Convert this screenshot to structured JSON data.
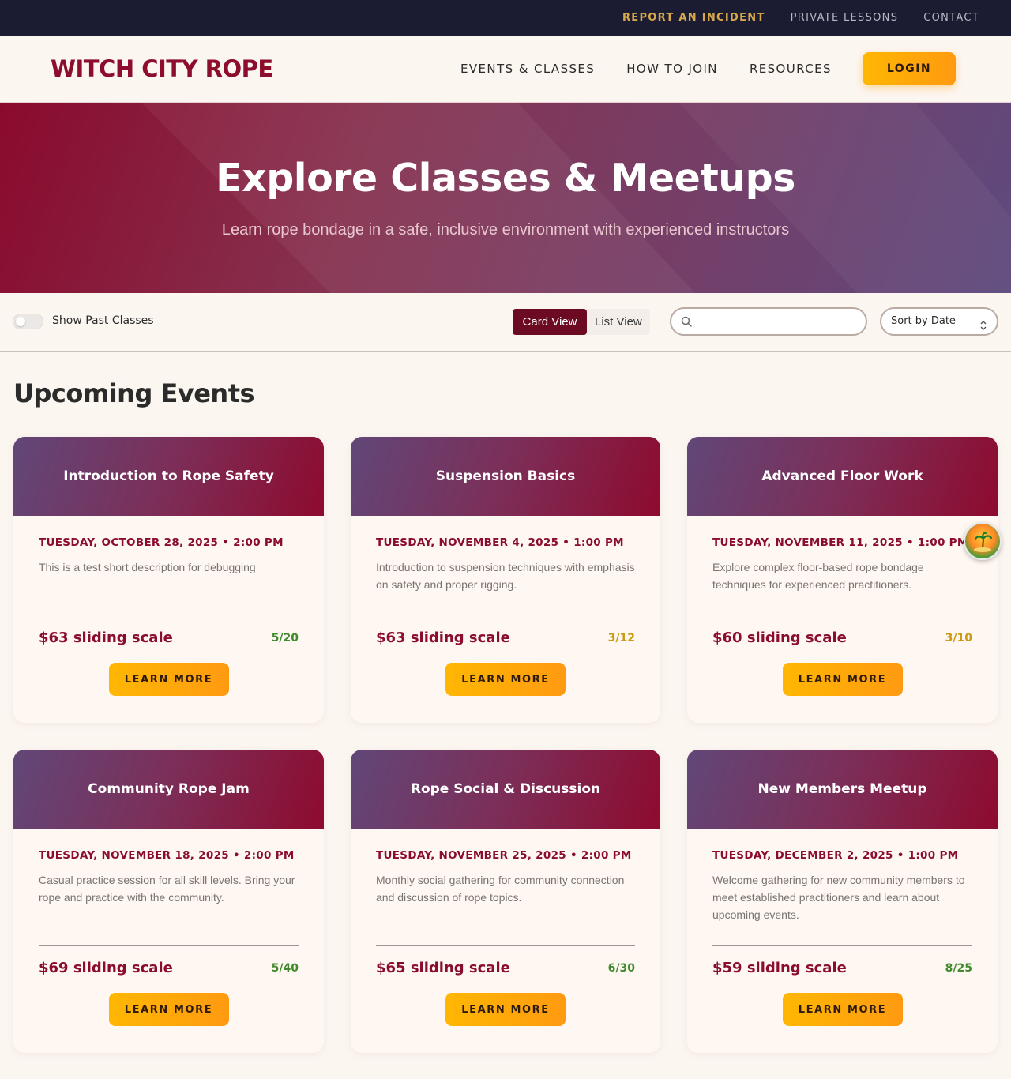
{
  "utility_nav": {
    "report_incident": "REPORT AN INCIDENT",
    "private_lessons": "PRIVATE LESSONS",
    "contact": "CONTACT"
  },
  "header": {
    "brand": "WITCH CITY ROPE",
    "nav": {
      "events": "EVENTS & CLASSES",
      "join": "HOW TO JOIN",
      "resources": "RESOURCES"
    },
    "login": "LOGIN"
  },
  "hero": {
    "title": "Explore Classes & Meetups",
    "subtitle": "Learn rope bondage in a safe, inclusive environment with experienced instructors"
  },
  "filters": {
    "show_past": "Show Past Classes",
    "show_past_on": false,
    "card_view": "Card View",
    "list_view": "List View",
    "search_placeholder": "",
    "sort": "Sort by Date"
  },
  "section_title": "Upcoming Events",
  "events": [
    {
      "title": "Introduction to Rope Safety",
      "date": "TUESDAY, OCTOBER 28, 2025 • 2:00 PM",
      "description": "This is a test short description for debugging",
      "price": "$63 sliding scale",
      "capacity": "5/20",
      "capacity_color": "#3f8a2c",
      "cta": "LEARN MORE"
    },
    {
      "title": "Suspension Basics",
      "date": "TUESDAY, NOVEMBER 4, 2025 • 1:00 PM",
      "description": "Introduction to suspension techniques with emphasis on safety and proper rigging.",
      "price": "$63 sliding scale",
      "capacity": "3/12",
      "capacity_color": "#c99a12",
      "cta": "LEARN MORE"
    },
    {
      "title": "Advanced Floor Work",
      "date": "TUESDAY, NOVEMBER 11, 2025 • 1:00 PM",
      "description": "Explore complex floor-based rope bondage techniques for experienced practitioners.",
      "price": "$60 sliding scale",
      "capacity": "3/10",
      "capacity_color": "#c99a12",
      "cta": "LEARN MORE"
    },
    {
      "title": "Community Rope Jam",
      "date": "TUESDAY, NOVEMBER 18, 2025 • 2:00 PM",
      "description": "Casual practice session for all skill levels. Bring your rope and practice with the community.",
      "price": "$69 sliding scale",
      "capacity": "5/40",
      "capacity_color": "#3f8a2c",
      "cta": "LEARN MORE"
    },
    {
      "title": "Rope Social & Discussion",
      "date": "TUESDAY, NOVEMBER 25, 2025 • 2:00 PM",
      "description": "Monthly social gathering for community connection and discussion of rope topics.",
      "price": "$65 sliding scale",
      "capacity": "6/30",
      "capacity_color": "#3f8a2c",
      "cta": "LEARN MORE"
    },
    {
      "title": "New Members Meetup",
      "date": "TUESDAY, DECEMBER 2, 2025 • 1:00 PM",
      "description": "Welcome gathering for new community members to meet established practitioners and learn about upcoming events.",
      "price": "$59 sliding scale",
      "capacity": "8/25",
      "capacity_color": "#3f8a2c",
      "cta": "LEARN MORE"
    }
  ],
  "icons": {
    "search": "search-icon",
    "sort": "chevron-updown-icon",
    "floating": "beach-island-icon"
  },
  "colors": {
    "brand": "#8c0d2c",
    "accent": "#ffb703",
    "utility_bg": "#1b1c32",
    "incident": "#d8a94a"
  }
}
